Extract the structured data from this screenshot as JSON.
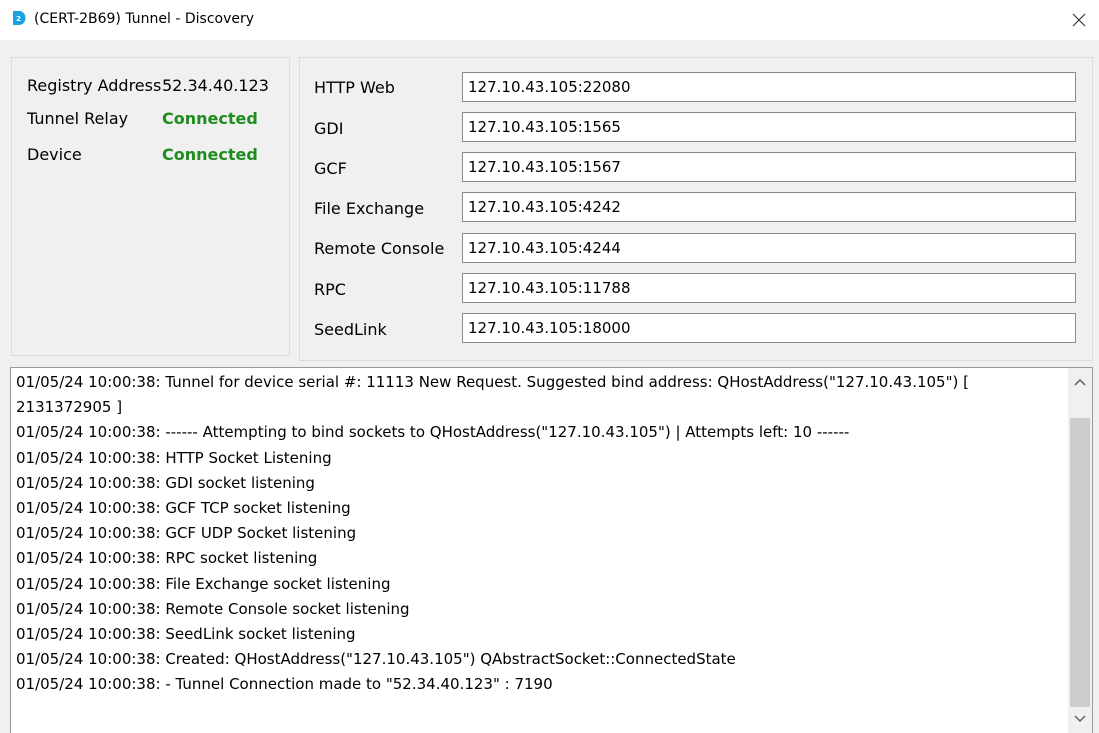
{
  "window": {
    "title": "(CERT-2B69) Tunnel - Discovery",
    "icon": "d2-app-icon",
    "close": "close-icon"
  },
  "status": {
    "registry_label": "Registry Address",
    "registry_value": "52.34.40.123",
    "relay_label": "Tunnel Relay",
    "relay_value": "Connected",
    "device_label": "Device",
    "device_value": "Connected",
    "connected_color": "#1e8c1e"
  },
  "ports": [
    {
      "label": "HTTP Web",
      "value": "127.10.43.105:22080"
    },
    {
      "label": "GDI",
      "value": "127.10.43.105:1565"
    },
    {
      "label": "GCF",
      "value": "127.10.43.105:1567"
    },
    {
      "label": "File Exchange",
      "value": "127.10.43.105:4242"
    },
    {
      "label": "Remote Console",
      "value": "127.10.43.105:4244"
    },
    {
      "label": "RPC",
      "value": "127.10.43.105:11788"
    },
    {
      "label": "SeedLink",
      "value": "127.10.43.105:18000"
    }
  ],
  "log": [
    "01/05/24 10:00:38: Tunnel for device serial #:  11113 New Request. Suggested bind address:  QHostAddress(\"127.10.43.105\")  [",
    "2131372905 ]",
    "01/05/24 10:00:38: ------ Attempting to bind sockets to  QHostAddress(\"127.10.43.105\")  | Attempts left:  10  ------",
    "01/05/24 10:00:38: HTTP Socket Listening",
    "01/05/24 10:00:38: GDI socket listening",
    "01/05/24 10:00:38: GCF TCP socket listening",
    "01/05/24 10:00:38: GCF UDP Socket listening",
    "01/05/24 10:00:38: RPC socket listening",
    "01/05/24 10:00:38: File Exchange socket listening",
    "01/05/24 10:00:38: Remote Console socket listening",
    "01/05/24 10:00:38: SeedLink socket listening",
    "01/05/24 10:00:38: Created:  QHostAddress(\"127.10.43.105\") QAbstractSocket::ConnectedState",
    "01/05/24 10:00:38: - Tunnel Connection made to \"52.34.40.123\" : 7190"
  ]
}
